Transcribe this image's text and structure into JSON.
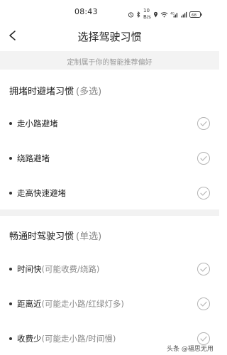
{
  "status": {
    "time": "08:43",
    "battery": "68"
  },
  "nav": {
    "title": "选择驾驶习惯"
  },
  "subtitle": "定制属于你的智能推荐偏好",
  "sections": [
    {
      "title": "拥堵时避堵习惯",
      "hint": "(多选)",
      "options": [
        {
          "label": "走小路避堵",
          "note": "",
          "checked": false
        },
        {
          "label": "绕路避堵",
          "note": "",
          "checked": false
        },
        {
          "label": "走高快速避堵",
          "note": "",
          "checked": false
        }
      ]
    },
    {
      "title": "畅通时驾驶习惯",
      "hint": "(单选)",
      "options": [
        {
          "label": "时间快",
          "note": "(可能收费/绕路)",
          "checked": false
        },
        {
          "label": "距离近",
          "note": "(可能走小路/红绿灯多)",
          "checked": false
        },
        {
          "label": "收费少",
          "note": "(可能走小路/时间慢)",
          "checked": false
        }
      ]
    }
  ],
  "watermark": "头条 @福思无用",
  "icons": {
    "back": "chevron-left-icon",
    "check": "check-circle-icon"
  },
  "colors": {
    "subtitle_bg": "#f3f3f3",
    "divider_bg": "#f2f2f2",
    "check_stroke": "#b5b5b5"
  }
}
